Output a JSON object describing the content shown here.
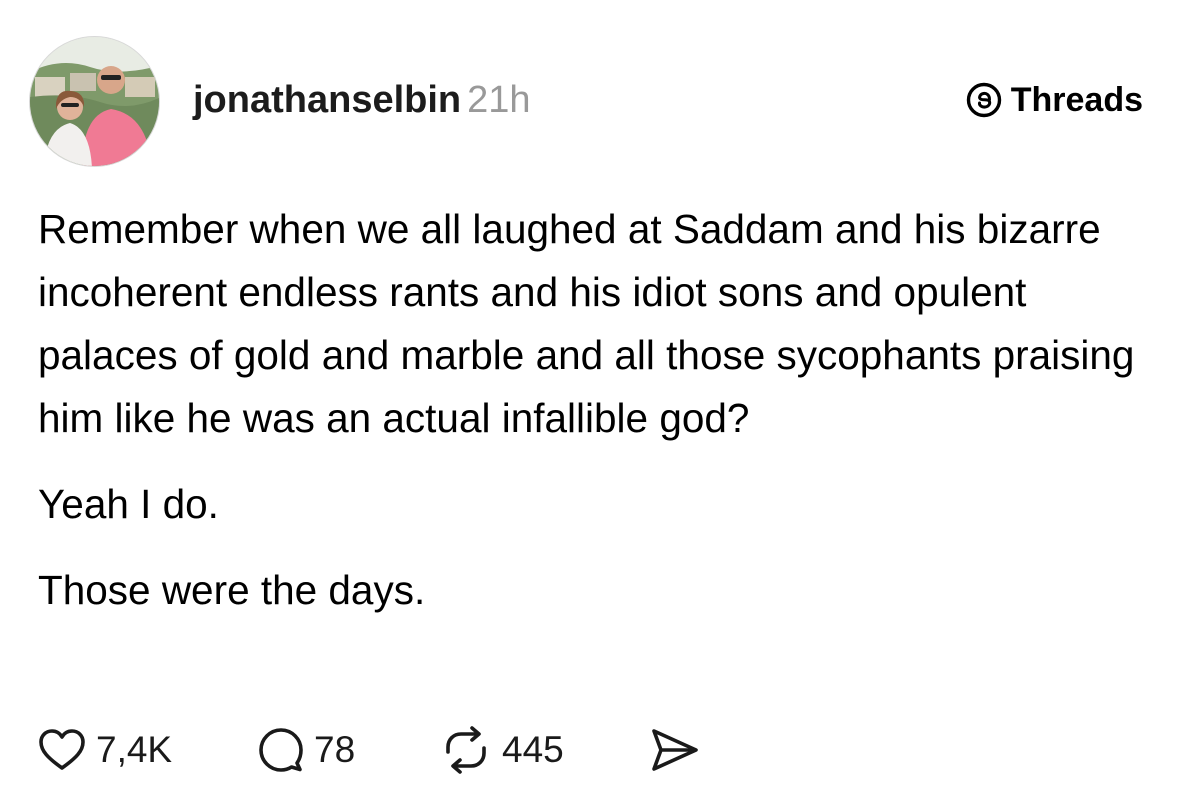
{
  "post": {
    "username": "jonathanselbin",
    "time_ago": "21h",
    "brand_label": "Threads",
    "paragraphs": [
      "Remember when we all laughed at Saddam and his bizarre incoherent endless rants and his idiot sons and opulent palaces of gold and marble and all those sycophants praising him like he was an actual infallible god?",
      "Yeah I do.",
      "Those were the days."
    ],
    "actions": {
      "likes": "7,4K",
      "replies": "78",
      "reposts": "445"
    }
  },
  "icons": {
    "like": "heart-icon",
    "reply": "comment-bubble-icon",
    "repost": "repost-icon",
    "share": "send-icon",
    "brand": "threads-logo-icon"
  }
}
